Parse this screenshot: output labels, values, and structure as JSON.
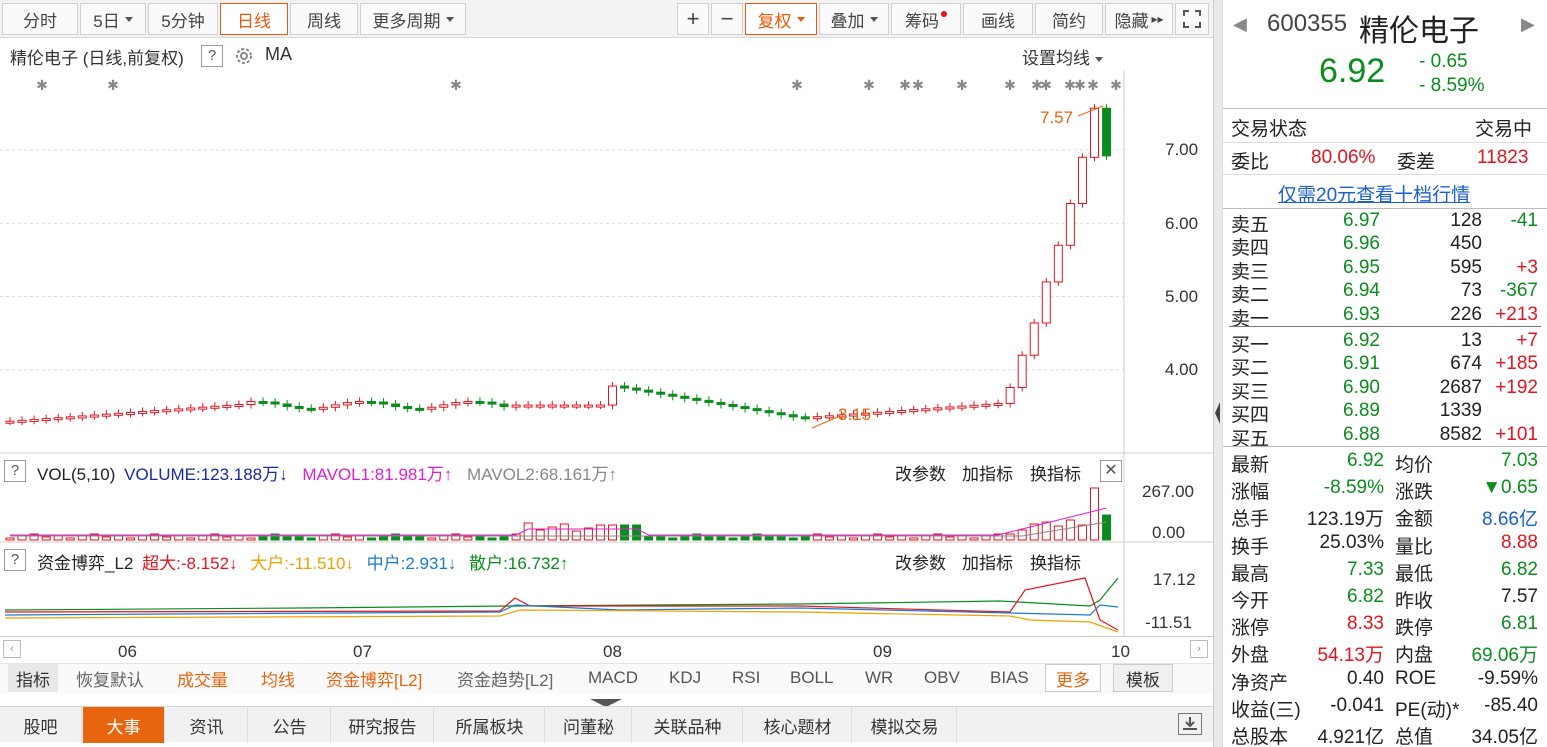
{
  "toolbar": {
    "items": [
      "分时",
      "5日",
      "5分钟",
      "日线",
      "周线",
      "更多周期"
    ],
    "plus": "+",
    "minus": "−",
    "fuquan": "复权",
    "diejia": "叠加",
    "chouma": "筹码",
    "huaxian": "画线",
    "jianyue": "简约",
    "yincang": "隐藏"
  },
  "chart": {
    "title": "精伦电子 (日线,前复权)",
    "help": "?",
    "ma": "MA",
    "setting": "设置均线",
    "price_ticks": [
      "7.00",
      "6.00",
      "5.00",
      "4.00"
    ],
    "high_label": "7.57",
    "low_label": "3.15",
    "date_labels": [
      "06",
      "07",
      "08",
      "09",
      "10"
    ]
  },
  "vol": {
    "header": "VOL(5,10)",
    "volume": "VOLUME:123.188万",
    "mavol1": "MAVOL1:81.981万",
    "mavol2": "MAVOL2:68.161万",
    "top": "267.00",
    "bottom": "0.00",
    "btn1": "改参数",
    "btn2": "加指标",
    "btn3": "换指标"
  },
  "fund": {
    "header": "资金博弈_L2",
    "super": "超大:-8.152",
    "big": "大户:-11.510",
    "mid": "中户:2.931",
    "small": "散户:16.732",
    "top": "17.12",
    "bottom": "-11.51"
  },
  "indicators": [
    "指标",
    "恢复默认",
    "成交量",
    "均线",
    "资金博弈[L2]",
    "资金趋势[L2]",
    "MACD",
    "KDJ",
    "RSI",
    "BOLL",
    "WR",
    "OBV",
    "BIAS",
    "更多",
    "模板"
  ],
  "tabs": [
    "股吧",
    "大事",
    "资讯",
    "公告",
    "研究报告",
    "所属板块",
    "问董秘",
    "关联品种",
    "核心题材",
    "模拟交易"
  ],
  "quote": {
    "code": "600355",
    "name": "精伦电子",
    "price": "6.92",
    "change": "- 0.65",
    "pct": "- 8.59%",
    "status_label": "交易状态",
    "status": "交易中",
    "weibi_label": "委比",
    "weibi": "80.06%",
    "weicha_label": "委差",
    "weicha": "11823",
    "link": "仅需20元查看十档行情",
    "asks": [
      {
        "l": "卖五",
        "p": "6.97",
        "v": "128",
        "c": "-41"
      },
      {
        "l": "卖四",
        "p": "6.96",
        "v": "450",
        "c": ""
      },
      {
        "l": "卖三",
        "p": "6.95",
        "v": "595",
        "c": "+3"
      },
      {
        "l": "卖二",
        "p": "6.94",
        "v": "73",
        "c": "-367"
      },
      {
        "l": "卖一",
        "p": "6.93",
        "v": "226",
        "c": "+213"
      }
    ],
    "bids": [
      {
        "l": "买一",
        "p": "6.92",
        "v": "13",
        "c": "+7"
      },
      {
        "l": "买二",
        "p": "6.91",
        "v": "674",
        "c": "+185"
      },
      {
        "l": "买三",
        "p": "6.90",
        "v": "2687",
        "c": "+192"
      },
      {
        "l": "买四",
        "p": "6.89",
        "v": "1339",
        "c": ""
      },
      {
        "l": "买五",
        "p": "6.88",
        "v": "8582",
        "c": "+101"
      }
    ],
    "stats": [
      [
        "最新",
        "6.92",
        "均价",
        "7.03"
      ],
      [
        "涨幅",
        "-8.59%",
        "涨跌",
        "▼0.65"
      ],
      [
        "总手",
        "123.19万",
        "金额",
        "8.66亿"
      ],
      [
        "换手",
        "25.03%",
        "量比",
        "8.88"
      ],
      [
        "最高",
        "7.33",
        "最低",
        "6.82"
      ],
      [
        "今开",
        "6.82",
        "昨收",
        "7.57"
      ],
      [
        "涨停",
        "8.33",
        "跌停",
        "6.81"
      ],
      [
        "外盘",
        "54.13万",
        "内盘",
        "69.06万"
      ],
      [
        "净资产",
        "0.40",
        "ROE",
        "-9.59%"
      ],
      [
        "收益(三)",
        "-0.041",
        "PE(动)*",
        "-85.40"
      ],
      [
        "总股本",
        "4.921亿",
        "总值",
        "34.05亿"
      ]
    ]
  },
  "colors": {
    "up": "#e3141f",
    "down": "#0b8c1e",
    "accent": "#e8650f"
  }
}
